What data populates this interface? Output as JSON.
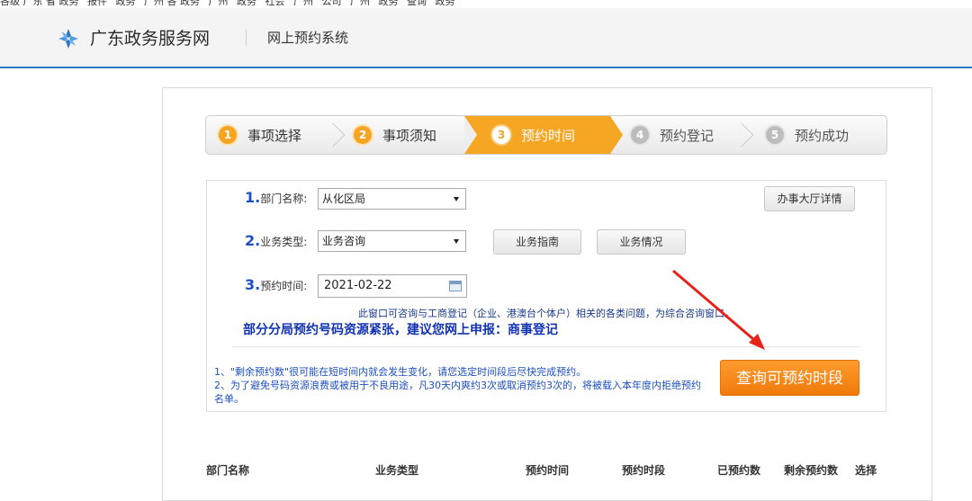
{
  "bookmarks": [
    "各级 广东 省 政务",
    "报件",
    "政务",
    "广州 各 政务",
    "广州",
    "政务",
    "社会",
    "广州",
    "公司",
    "广州",
    "政务",
    "查询",
    "政务"
  ],
  "header": {
    "site_name": "广东政务服务网",
    "system_name": "网上预约系统",
    "accent_color": "#2d78c8"
  },
  "steps": [
    {
      "num": "1",
      "label": "事项选择",
      "state": "done"
    },
    {
      "num": "2",
      "label": "事项须知",
      "state": "done"
    },
    {
      "num": "3",
      "label": "预约时间",
      "state": "active"
    },
    {
      "num": "4",
      "label": "预约登记",
      "state": "todo"
    },
    {
      "num": "5",
      "label": "预约成功",
      "state": "todo"
    }
  ],
  "form": {
    "dept": {
      "num": "1.",
      "label": "部门名称:",
      "value": "从化区局"
    },
    "biz": {
      "num": "2.",
      "label": "业务类型:",
      "value": "业务咨询"
    },
    "date": {
      "num": "3.",
      "label": "预约时间:",
      "value": "2021-02-22"
    },
    "hall_details_btn": "办事大厅详情",
    "guide_btn": "业务指南",
    "status_btn": "业务情况"
  },
  "notice": {
    "small": "此窗口可咨询与工商登记（企业、港澳台个体户）相关的各类问题，为综合咨询窗口。",
    "big": "部分分局预约号码资源紧张，建议您网上申报：",
    "big_link": "商事登记"
  },
  "tips": {
    "t1": "1、\"剩余预约数\"很可能在短时间内就会发生变化，请您选定时间段后尽快完成预约。",
    "t2": "2、为了避免号码资源浪费或被用于不良用途，凡30天内爽约3次或取消预约3次的，将被载入本年度内拒绝预约名单。"
  },
  "query_btn": "查询可预约时段",
  "table": {
    "headers": [
      "部门名称",
      "业务类型",
      "预约时间",
      "预约时段",
      "已预约数",
      "剩余预约数",
      "选择"
    ]
  }
}
